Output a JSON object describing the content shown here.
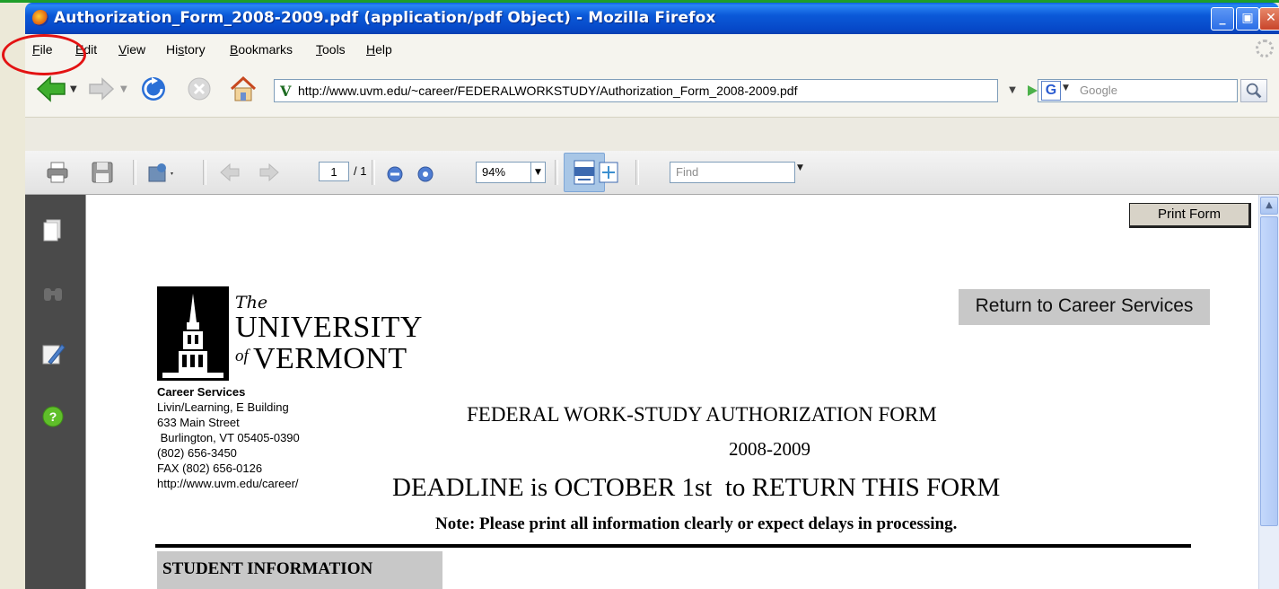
{
  "window": {
    "title": "Authorization_Form_2008-2009.pdf (application/pdf Object) - Mozilla Firefox"
  },
  "menu": {
    "items": [
      {
        "key": "F",
        "rest": "ile"
      },
      {
        "key": "E",
        "rest": "dit"
      },
      {
        "key": "V",
        "rest": "iew"
      },
      {
        "key": "s",
        "pre": "Hi",
        "rest": "tory"
      },
      {
        "key": "B",
        "rest": "ookmarks"
      },
      {
        "key": "T",
        "rest": "ools"
      },
      {
        "key": "H",
        "rest": "elp"
      }
    ]
  },
  "nav": {
    "url": "http://www.uvm.edu/~career/FEDERALWORKSTUDY/Authorization_Form_2008-2009.pdf",
    "url_favicon": "V",
    "search_placeholder": "Google",
    "search_engine_letter": "G"
  },
  "pdf_toolbar": {
    "page_current": "1",
    "page_total": "/ 1",
    "zoom": "94%",
    "find_placeholder": "Find"
  },
  "document": {
    "print_button": "Print Form",
    "return_button": "Return to Career Services",
    "logo": {
      "the": "The",
      "university": "UNIVERSITY",
      "of": "of",
      "vermont": "VERMONT"
    },
    "address": {
      "dept": "Career Services",
      "line1": "Livin/Learning, E Building",
      "line2": "633 Main Street",
      "line3": " Burlington, VT 05405-0390",
      "line4": "(802) 656-3450",
      "line5": "FAX (802) 656-0126",
      "line6": "http://www.uvm.edu/career/"
    },
    "form_title": "FEDERAL WORK-STUDY AUTHORIZATION FORM",
    "year": "2008-2009",
    "deadline": "DEADLINE is OCTOBER 1st  to RETURN THIS FORM",
    "note": "Note: Please print all information clearly or expect delays in processing.",
    "section_heading": "STUDENT INFORMATION"
  },
  "colors": {
    "titlebar": "#0b59d8",
    "annotation": "#e31313",
    "pdf_sidebar": "#4a4a4a",
    "accent_green": "#1e9e2a"
  }
}
